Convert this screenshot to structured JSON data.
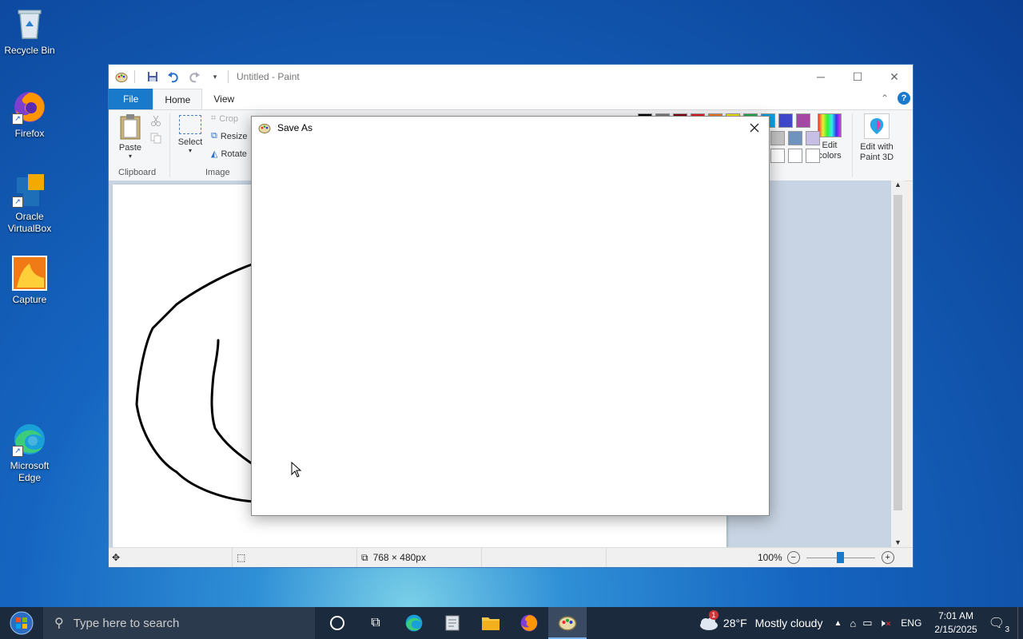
{
  "desktop": {
    "icons": [
      {
        "label": "Recycle Bin"
      },
      {
        "label": "Firefox"
      },
      {
        "label": "Oracle VirtualBox"
      },
      {
        "label": "Capture"
      },
      {
        "label": "Microsoft Edge"
      }
    ]
  },
  "paint": {
    "title": "Untitled - Paint",
    "tabs": [
      "File",
      "Home",
      "View"
    ],
    "clipboard": {
      "paste": "Paste",
      "group": "Clipboard"
    },
    "image": {
      "select": "Select",
      "crop": "Crop",
      "resize": "Resize",
      "rotate": "Rotate",
      "group": "Image"
    },
    "colors": {
      "edit_colors": "Edit colors",
      "edit_paint3d": "Edit with Paint 3D",
      "palette": [
        "#000000",
        "#7f7f7f",
        "#880015",
        "#ed1c24",
        "#ff7f27",
        "#fff200",
        "#22b14c",
        "#00a2e8",
        "#3f48cc",
        "#a349a4"
      ],
      "palette2": [
        "#c3c3c3",
        "#7092be",
        "#c8bfe7"
      ]
    },
    "status": {
      "dimensions": "768 × 480px",
      "zoom": "100%"
    }
  },
  "dialog": {
    "title": "Save As"
  },
  "taskbar": {
    "search_placeholder": "Type here to search",
    "weather_temp": "28°F",
    "weather_text": "Mostly cloudy",
    "weather_badge": "1",
    "language": "ENG",
    "time": "7:01 AM",
    "date": "2/15/2025",
    "notifications": "3"
  }
}
